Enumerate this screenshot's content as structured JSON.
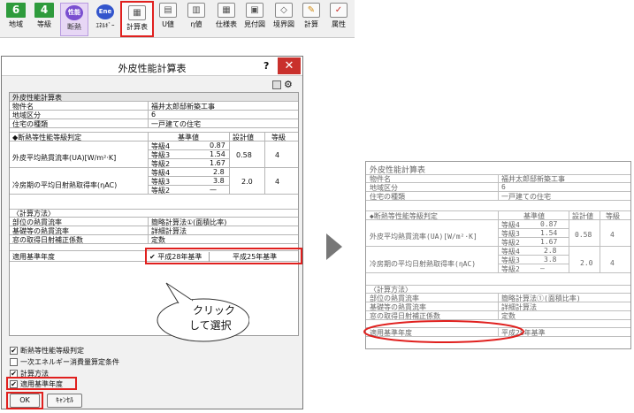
{
  "toolbar": {
    "items": [
      {
        "glyph": "6",
        "label": "地域",
        "color": "#2e9b3c"
      },
      {
        "glyph": "4",
        "label": "等級",
        "color": "#2e9b3c"
      },
      {
        "glyph": "性能",
        "label": "断熱",
        "color": "#7a4fd0"
      },
      {
        "glyph": "Ene",
        "label": "ｴﾈﾙｷﾞｰ",
        "color": "#3355cc"
      },
      {
        "glyph": "▦",
        "label": "計算表"
      },
      {
        "glyph": "▤",
        "label": "U値"
      },
      {
        "glyph": "▥",
        "label": "η値"
      },
      {
        "glyph": "▦",
        "label": "仕様表"
      },
      {
        "glyph": "▣",
        "label": "見付図"
      },
      {
        "glyph": "◇",
        "label": "境界図"
      },
      {
        "glyph": "✎",
        "label": "計算"
      },
      {
        "glyph": "✓",
        "label": "属性"
      }
    ]
  },
  "dialog": {
    "title": "外皮性能計算表",
    "help": "?",
    "close": "✕",
    "table": {
      "heading": "外皮性能計算表",
      "project_label": "物件名",
      "project_value": "福井太郎邸新築工事",
      "region_label": "地域区分",
      "region_value": "6",
      "house_label": "住宅の種類",
      "house_value": "一戸建ての住宅",
      "judge_header": "◆断熱等性能等級判定",
      "col_std": "基準値",
      "col_calc": "設計値",
      "col_grade": "等級",
      "ua_label": "外皮平均熱貫流率(UA)[W/m²·K]",
      "ua_rows": [
        {
          "grade": "等級4",
          "value": "0.87"
        },
        {
          "grade": "等級3",
          "value": "1.54"
        },
        {
          "grade": "等級2",
          "value": "1.67"
        }
      ],
      "ua_design": "0.58",
      "ua_grade": "4",
      "eta_label": "冷房期の平均日射熱取得率(ηAC)",
      "eta_rows": [
        {
          "grade": "等級4",
          "value": "2.8"
        },
        {
          "grade": "等級3",
          "value": "3.8"
        },
        {
          "grade": "等級2",
          "value": "—"
        }
      ],
      "eta_design": "2.0",
      "eta_grade": "4",
      "method_header": "〈計算方法〉",
      "m1_label": "部位の熱貫流率",
      "m1_value": "簡略計算法①(面積比率)",
      "m2_label": "基礎等の熱貫流率",
      "m2_value": "詳細計算法",
      "m3_label": "窓の取得日射補正係数",
      "m3_value": "定数",
      "year_label": "適用基準年度",
      "year_opt1": "✔ 平成28年基準",
      "year_opt2": "平成25年基準"
    },
    "callout": [
      "クリック",
      "して選択"
    ],
    "checks": [
      {
        "label": "断熱等性能等級判定",
        "checked": "✔"
      },
      {
        "label": "一次エネルギー消費量算定条件",
        "checked": ""
      },
      {
        "label": "計算方法",
        "checked": "✔"
      },
      {
        "label": "適用基準年度",
        "checked": "✔"
      }
    ],
    "ok": "OK",
    "cancel": "ｷｬﾝｾﾙ"
  },
  "preview": {
    "year_value": "平成28年基準"
  },
  "colors": {
    "highlight": "#e0201e",
    "close": "#c9302c"
  }
}
